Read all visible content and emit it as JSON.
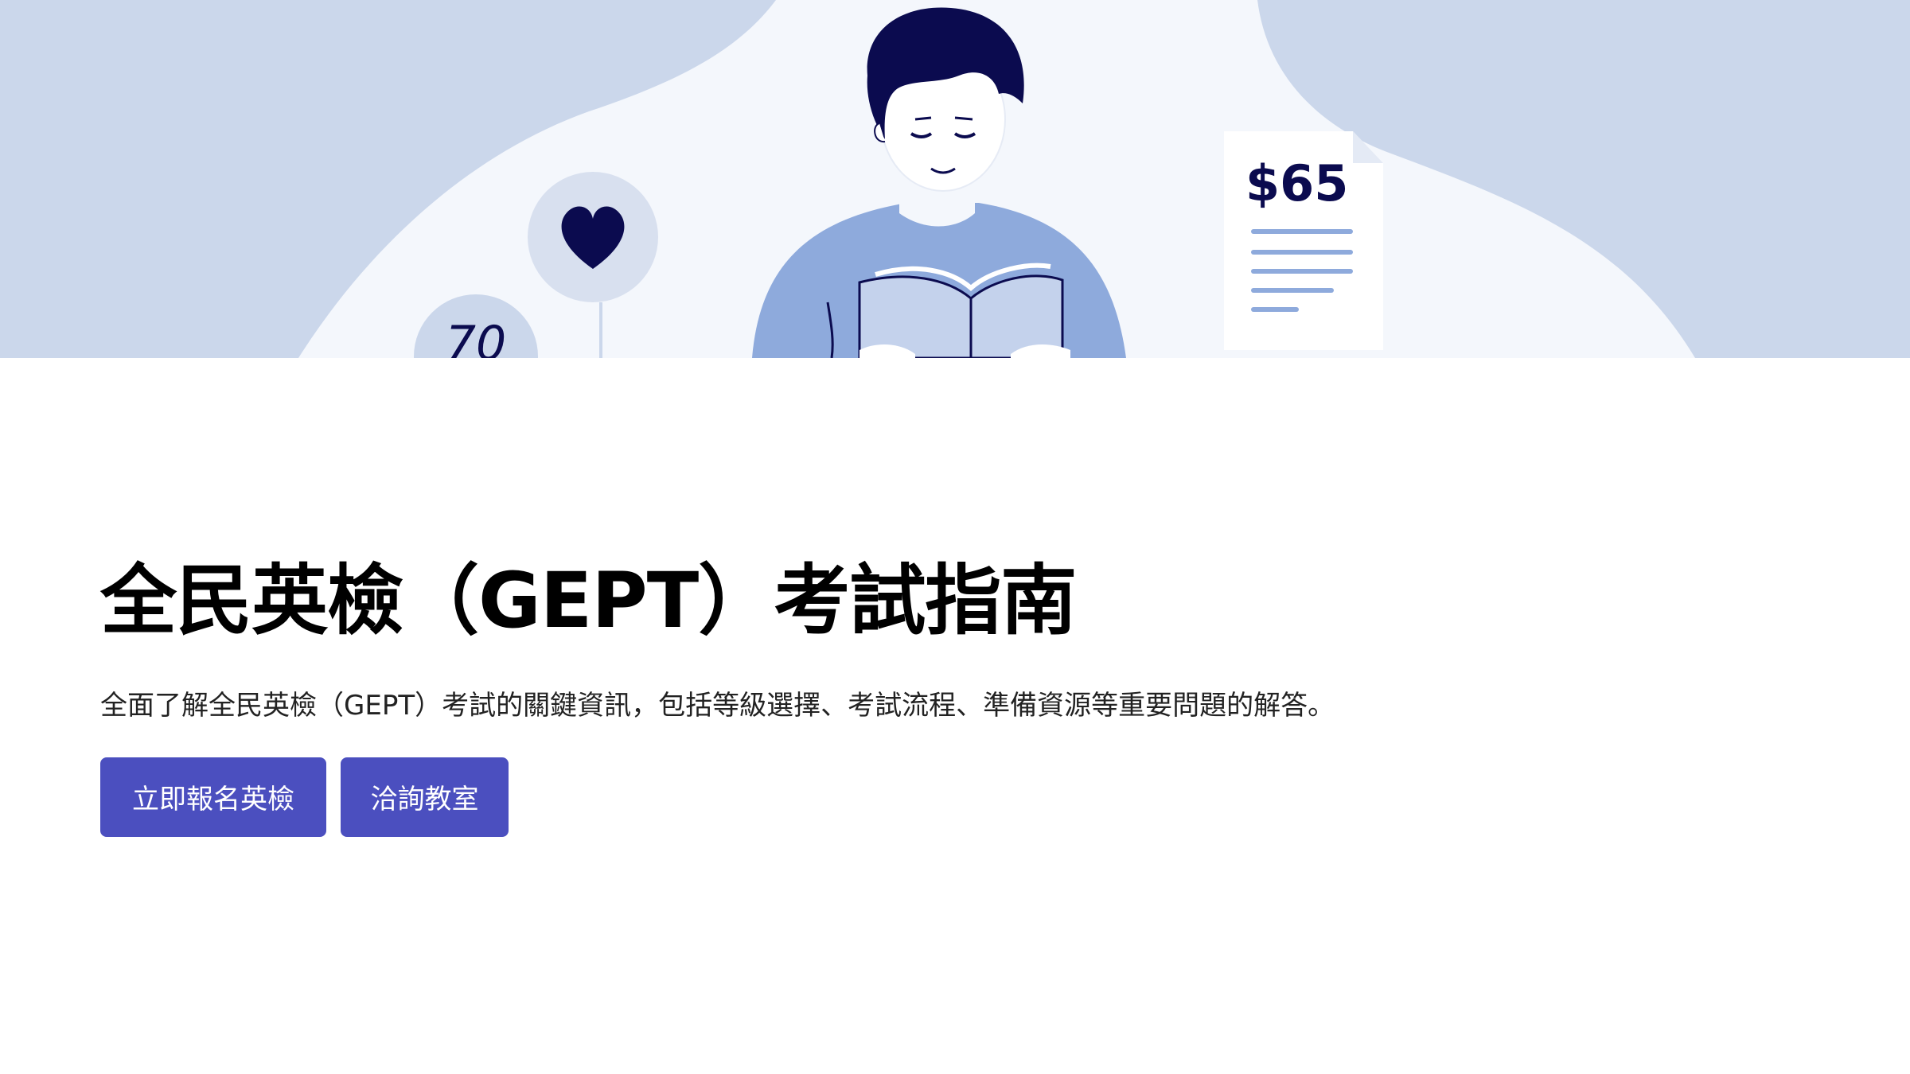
{
  "hero": {
    "price_tag": "$65",
    "badge_text": "70",
    "illustration_icons": [
      "heart-icon",
      "price-receipt-icon",
      "book-icon"
    ],
    "colors": {
      "background_blue": "#cbd7eb",
      "light_blob": "#f4f7fc",
      "navy": "#0b0b4f",
      "shirt_blue": "#8eaadc"
    }
  },
  "main": {
    "title": "全民英檢（GEPT）考試指南",
    "subtitle": "全面了解全民英檢（GEPT）考試的關鍵資訊，包括等級選擇、考試流程、準備資源等重要問題的解答。",
    "buttons": [
      {
        "label": "立即報名英檢"
      },
      {
        "label": "洽詢教室"
      }
    ]
  },
  "colors": {
    "button_bg": "#4b4fbf",
    "button_text": "#ffffff",
    "title_text": "#000000"
  }
}
